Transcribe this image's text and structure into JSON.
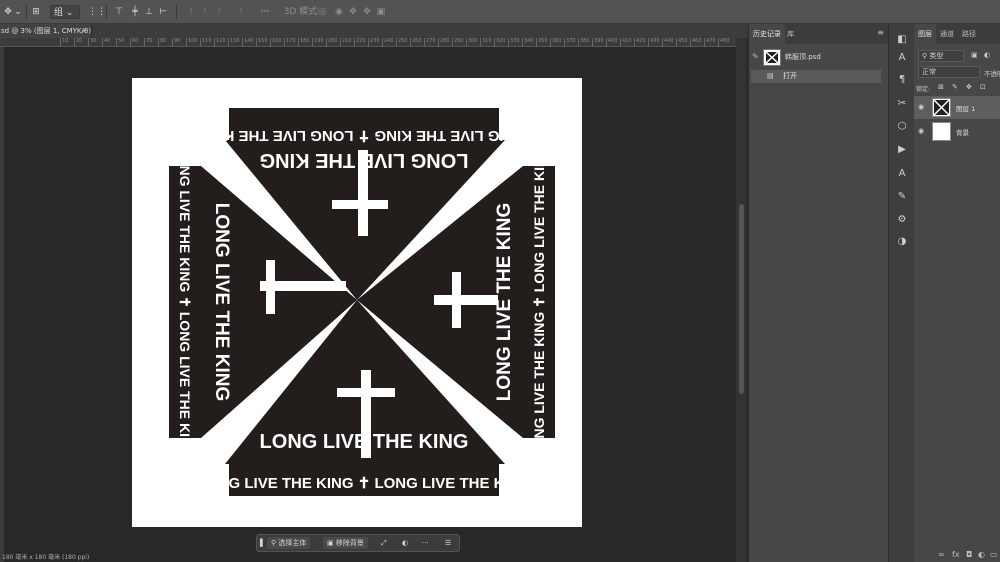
{
  "options_bar": {
    "align_select": "组",
    "mode_3d_label": "3D 模式:"
  },
  "document_tab": {
    "title": "sd @ 3% (图层 1, CMYK/8)",
    "close": "×"
  },
  "ruler": {
    "ticks": [
      "10",
      "20",
      "30",
      "40",
      "50",
      "60",
      "70",
      "80",
      "90",
      "100",
      "110",
      "120",
      "130",
      "140",
      "150",
      "160",
      "170",
      "180",
      "190",
      "200",
      "210",
      "220",
      "230",
      "240",
      "250",
      "260",
      "270",
      "280",
      "290",
      "300",
      "310",
      "320",
      "330",
      "340",
      "350",
      "360",
      "370",
      "380",
      "390",
      "400",
      "410",
      "420",
      "430",
      "440",
      "450",
      "460",
      "470",
      "480",
      "490",
      "500"
    ]
  },
  "artwork": {
    "top_strip": "LONG LIVE THE KING  ✝  LONG LIVE THE KING",
    "top_inner": "LONG LIVE THE KING",
    "left_strip": "LONG LIVE THE KING  ✝  LONG LIVE THE KING",
    "left_inner": "LONG LIVE THE KING",
    "right_strip": "LONG LIVE THE KING  ✝  LONG LIVE THE KING",
    "right_inner": "LONG LIVE THE KING",
    "bottom_inner": "LONG LIVE THE KING",
    "bottom_strip": "LONG LIVE THE KING  ✝  LONG LIVE THE KING",
    "ink_color": "#231d1c"
  },
  "taskbar": {
    "select_subject": "选择主体",
    "remove_bg": "移除背景",
    "more": "···"
  },
  "status": "180 毫米 x 180 毫米 (180 ppi)",
  "history_panel": {
    "tabs": [
      "历史记录",
      "库"
    ],
    "snapshot": "韩服顶.psd",
    "step_open": "打开"
  },
  "layers_panel": {
    "tabs": [
      "图层",
      "通道",
      "路径"
    ],
    "filter": "类型",
    "blend_mode": "正常",
    "opacity_label": "不透明",
    "lock_label": "锁定:",
    "layers": [
      {
        "name": "图层 1"
      },
      {
        "name": "背景"
      }
    ]
  }
}
